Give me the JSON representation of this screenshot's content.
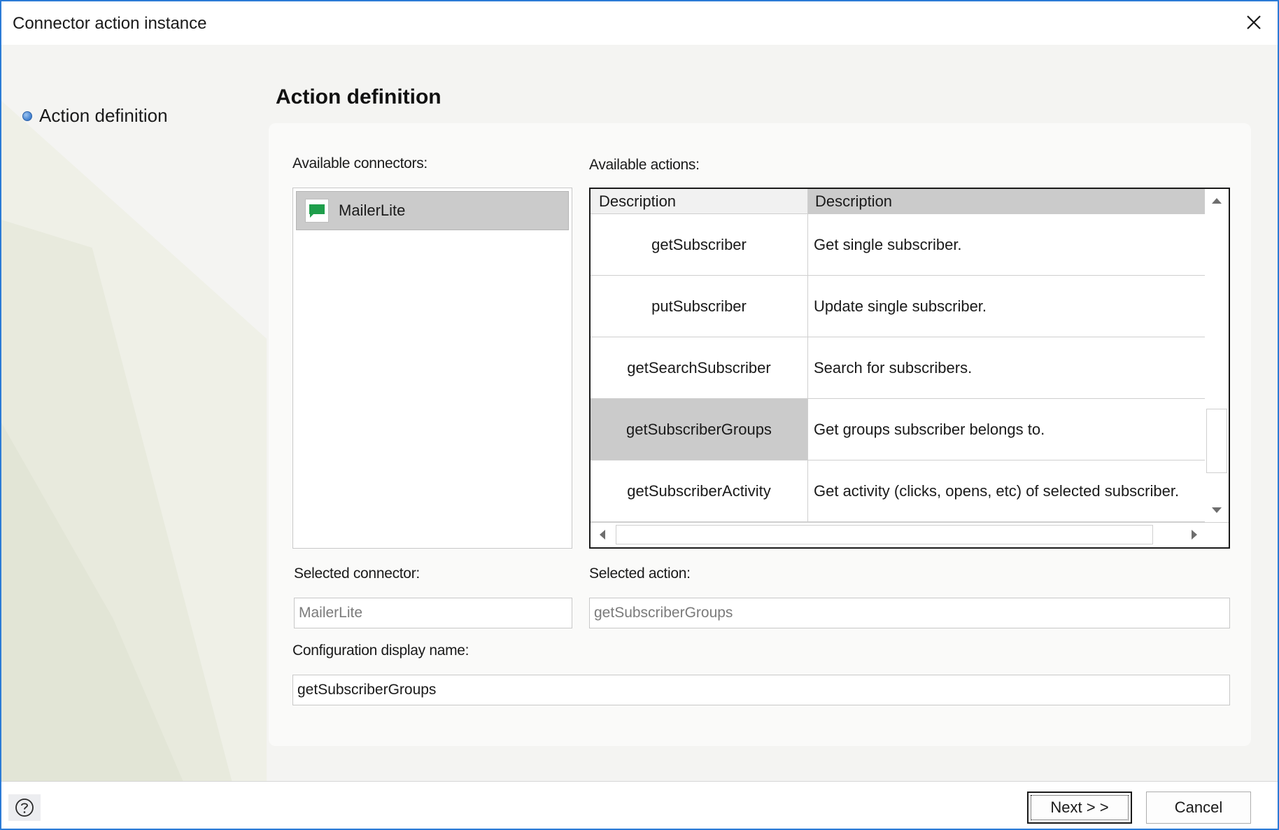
{
  "window": {
    "title": "Connector action instance"
  },
  "nav": {
    "steps": [
      {
        "label": "Action definition"
      }
    ]
  },
  "page": {
    "title": "Action definition"
  },
  "connectors": {
    "label": "Available connectors:",
    "items": [
      {
        "label": "MailerLite",
        "icon": "chat-bubble-icon",
        "color": "#1e9e4b"
      }
    ]
  },
  "actions": {
    "label": "Available actions:",
    "columns": [
      "Description",
      "Description"
    ],
    "rows": [
      {
        "name": "getSubscriber",
        "description": "Get single subscriber."
      },
      {
        "name": "putSubscriber",
        "description": "Update single subscriber."
      },
      {
        "name": "getSearchSubscriber",
        "description": "Search for subscribers."
      },
      {
        "name": "getSubscriberGroups",
        "description": "Get groups subscriber belongs to.",
        "selected": true
      },
      {
        "name": "getSubscriberActivity",
        "description": "Get activity (clicks, opens, etc) of selected subscriber."
      }
    ]
  },
  "selected_connector": {
    "label": "Selected connector:",
    "value": "MailerLite"
  },
  "selected_action": {
    "label": "Selected action:",
    "value": "getSubscriberGroups"
  },
  "display_name": {
    "label": "Configuration display name:",
    "value": "getSubscriberGroups"
  },
  "footer": {
    "next_label": "Next > >",
    "cancel_label": "Cancel"
  },
  "colors": {
    "accent_border": "#2b7bd6",
    "selection_gray": "#cbcbcb"
  }
}
